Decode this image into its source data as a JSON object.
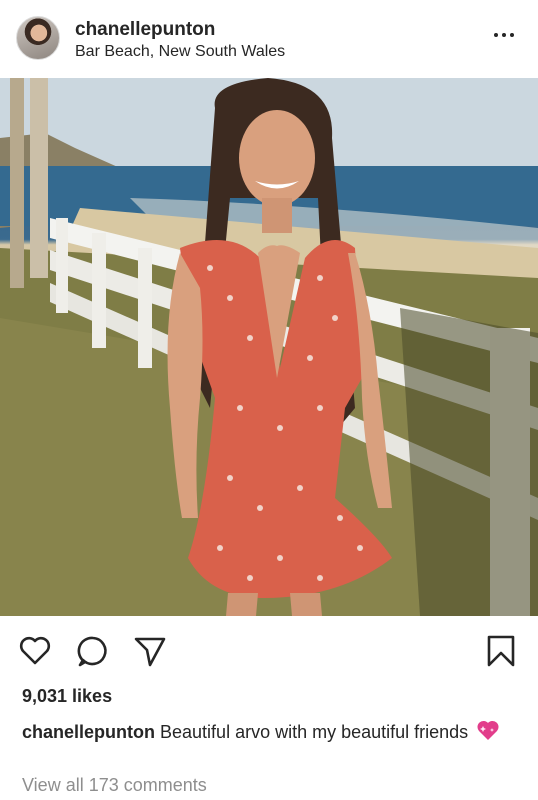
{
  "post": {
    "username": "chanellepunton",
    "location": "Bar Beach, New South Wales",
    "likes": "9,031 likes",
    "caption_username": "chanellepunton",
    "caption_text": " Beautiful arvo with my beautiful friends",
    "view_comments": "View all 173 comments"
  },
  "icons": {
    "more": "more-options-icon",
    "like": "heart-icon",
    "comment": "comment-icon",
    "share": "share-icon",
    "save": "bookmark-icon",
    "emoji": "sparkling-heart-emoji"
  },
  "colors": {
    "text": "#262626",
    "muted": "#8e8e8e",
    "emoji": "#e23d8b"
  }
}
